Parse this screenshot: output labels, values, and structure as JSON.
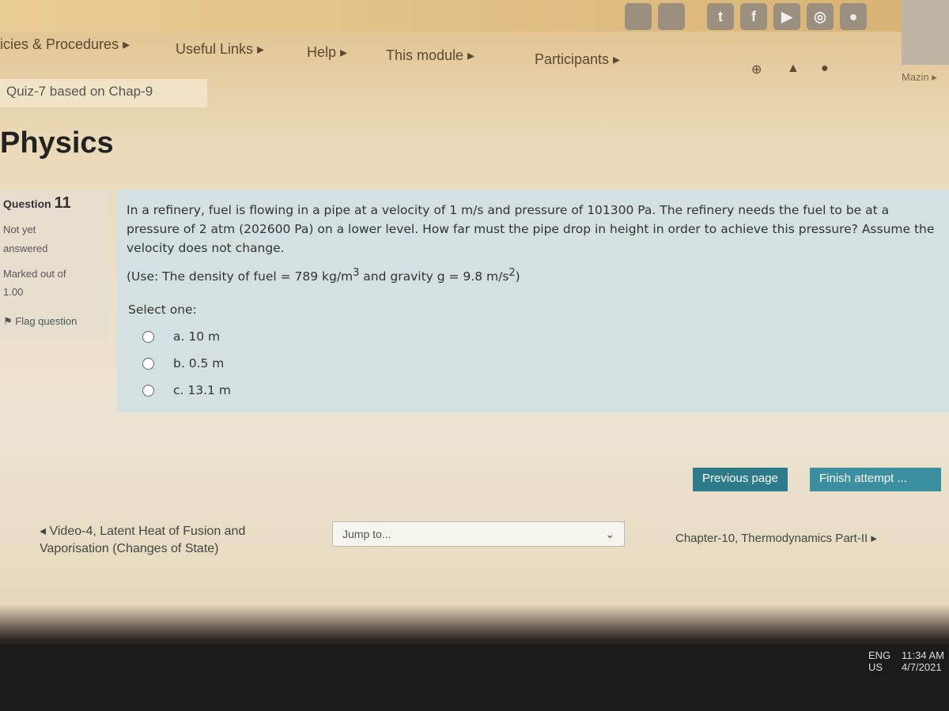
{
  "nav": {
    "items": [
      "icies & Procedures ▸",
      "Useful Links ▸",
      "Help ▸",
      "This module ▸",
      "Participants ▸"
    ],
    "user": "Mazin ▸",
    "social_icons": [
      "apple-icon",
      "android-icon",
      "twitter-icon",
      "facebook-icon",
      "youtube-icon",
      "instagram-icon",
      "globe-icon"
    ]
  },
  "breadcrumb": "Quiz-7 based on Chap-9",
  "title": "Physics",
  "info": {
    "question_label": "Question",
    "question_number": "11",
    "status": "Not yet answered",
    "marked": "Marked out of",
    "mark": "1.00",
    "flag": "Flag question"
  },
  "question": {
    "text": "In a refinery, fuel is flowing in a pipe at a velocity of 1 m/s and pressure of 101300 Pa. The refinery needs the fuel to be at a pressure of 2 atm (202600 Pa) on a lower level. How far must the pipe drop in height in order to achieve this pressure? Assume the velocity does not change.",
    "use_a": "(Use: The density of fuel = 789 kg/m",
    "sup3": "3",
    "use_b": " and gravity g = 9.8 m/s",
    "sup2": "2",
    "use_c": ")",
    "select": "Select one:",
    "options": [
      "a. 10 m",
      "b. 0.5 m",
      "c. 13.1 m"
    ]
  },
  "buttons": {
    "previous": "Previous page",
    "finish": "Finish attempt ..."
  },
  "footer": {
    "prev_link": "◂ Video-4, Latent Heat of Fusion and Vaporisation (Changes of State)",
    "jump": "Jump to...",
    "next_link": "Chapter-10, Thermodynamics Part-II ▸"
  },
  "taskbar": {
    "lang": "ENG",
    "region": "US",
    "time": "11:34 AM",
    "date": "4/7/2021"
  }
}
